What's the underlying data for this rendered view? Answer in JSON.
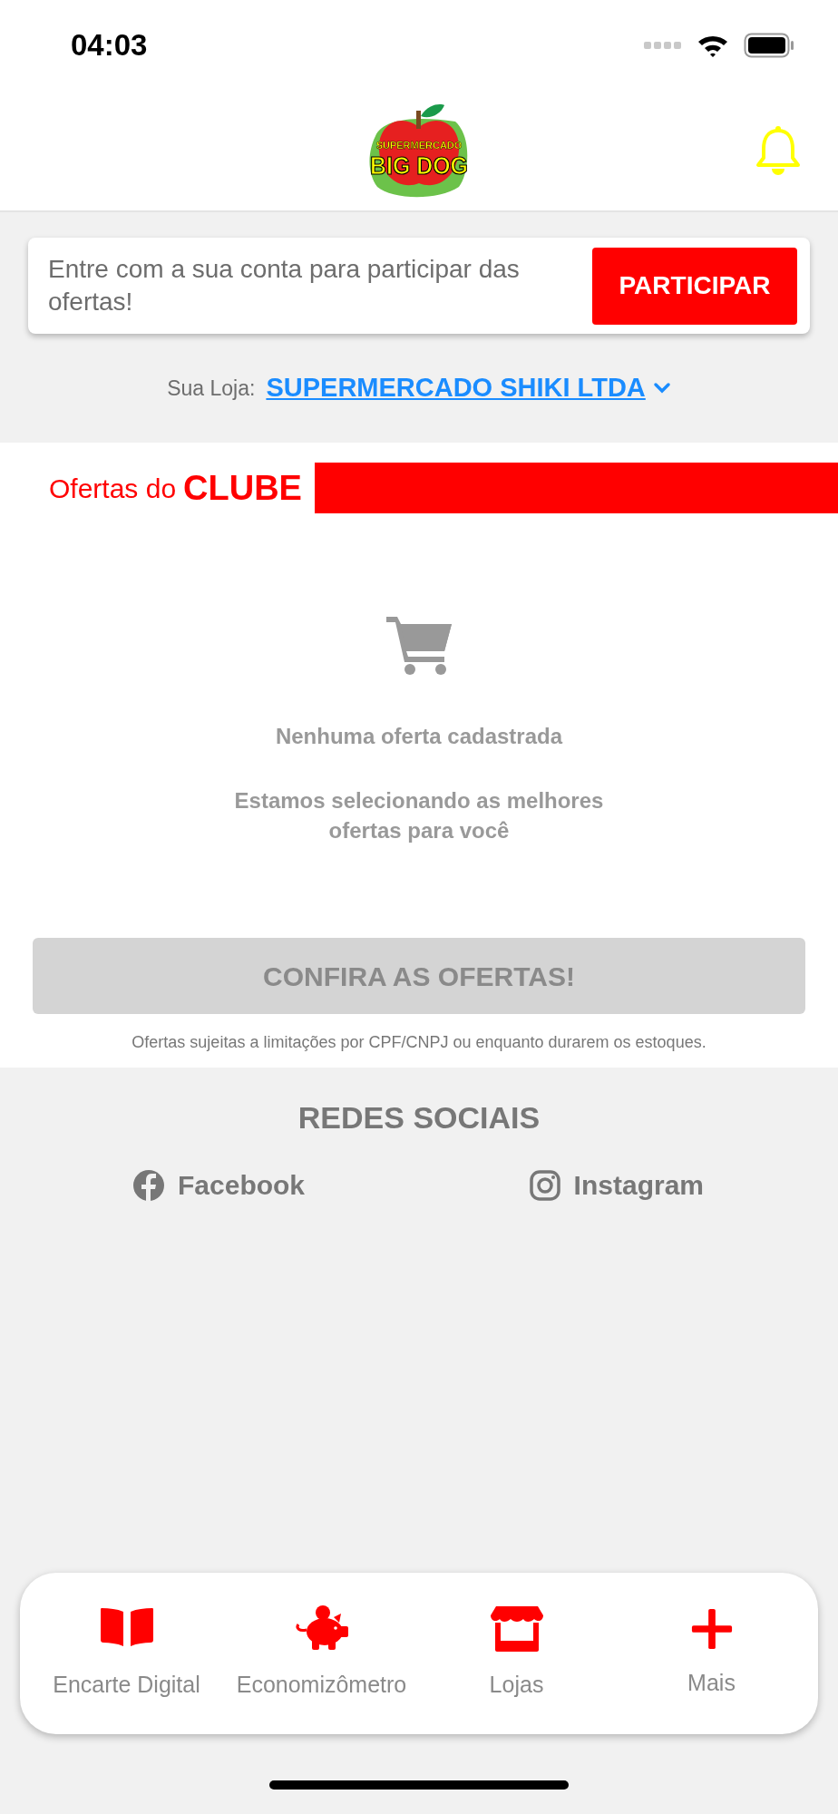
{
  "status_bar": {
    "time": "04:03"
  },
  "header": {
    "logo": {
      "line1": "SUPERMERCADO",
      "line2": "BIG DOG"
    }
  },
  "login_banner": {
    "message": "Entre com a sua conta para participar das ofertas!",
    "button": "PARTICIPAR"
  },
  "store": {
    "label": "Sua Loja:",
    "name": "SUPERMERCADO SHIKI LTDA"
  },
  "club": {
    "prefix": "Ofertas do",
    "title": "CLUBE"
  },
  "empty_state": {
    "title": "Nenhuma oferta cadastrada",
    "message": "Estamos selecionando as melhores ofertas para você"
  },
  "offers_button": {
    "label": "CONFIRA AS OFERTAS!",
    "disabled": true
  },
  "disclaimer": "Ofertas sujeitas a limitações por CPF/CNPJ ou enquanto durarem os estoques.",
  "social": {
    "title": "REDES SOCIAIS",
    "links": [
      {
        "kind": "facebook",
        "label": "Facebook"
      },
      {
        "kind": "instagram",
        "label": "Instagram"
      }
    ]
  },
  "tab_bar": [
    {
      "kind": "book",
      "label": "Encarte Digital"
    },
    {
      "kind": "piggy",
      "label": "Economizômetro"
    },
    {
      "kind": "store",
      "label": "Lojas"
    },
    {
      "kind": "plus",
      "label": "Mais"
    }
  ]
}
